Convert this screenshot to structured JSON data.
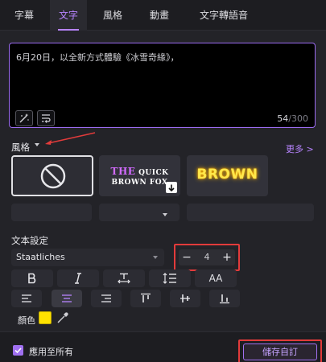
{
  "tabs": [
    {
      "label": "字幕"
    },
    {
      "label": "文字"
    },
    {
      "label": "風格"
    },
    {
      "label": "動畫"
    },
    {
      "label": "文字轉語音"
    }
  ],
  "text_input": {
    "value": "6月20日，以全新方式體驗《冰雪奇緣》，",
    "char_count": "54",
    "char_max": "/300"
  },
  "style_section": {
    "label": "風格",
    "more_link": "更多 >",
    "presets": [
      {
        "name": "none",
        "line1_prefix": "",
        "line1_rest": "",
        "line2": ""
      },
      {
        "name": "the-quick-brown-fox",
        "line1_prefix": "THE",
        "line1_rest": " QUICK",
        "line2": "BROWN FOX"
      },
      {
        "name": "brown-glow",
        "text": "BROWN"
      }
    ]
  },
  "text_settings": {
    "label": "文本設定",
    "font": "Staatliches",
    "size_value": "4",
    "case_label": "AA",
    "color_label": "顏色",
    "color_value": "#ffe200"
  },
  "footer": {
    "apply_all_label": "應用至所有",
    "save_label": "儲存自訂"
  },
  "colors": {
    "accent": "#b784ff",
    "annotation_red": "#e23b3b"
  }
}
